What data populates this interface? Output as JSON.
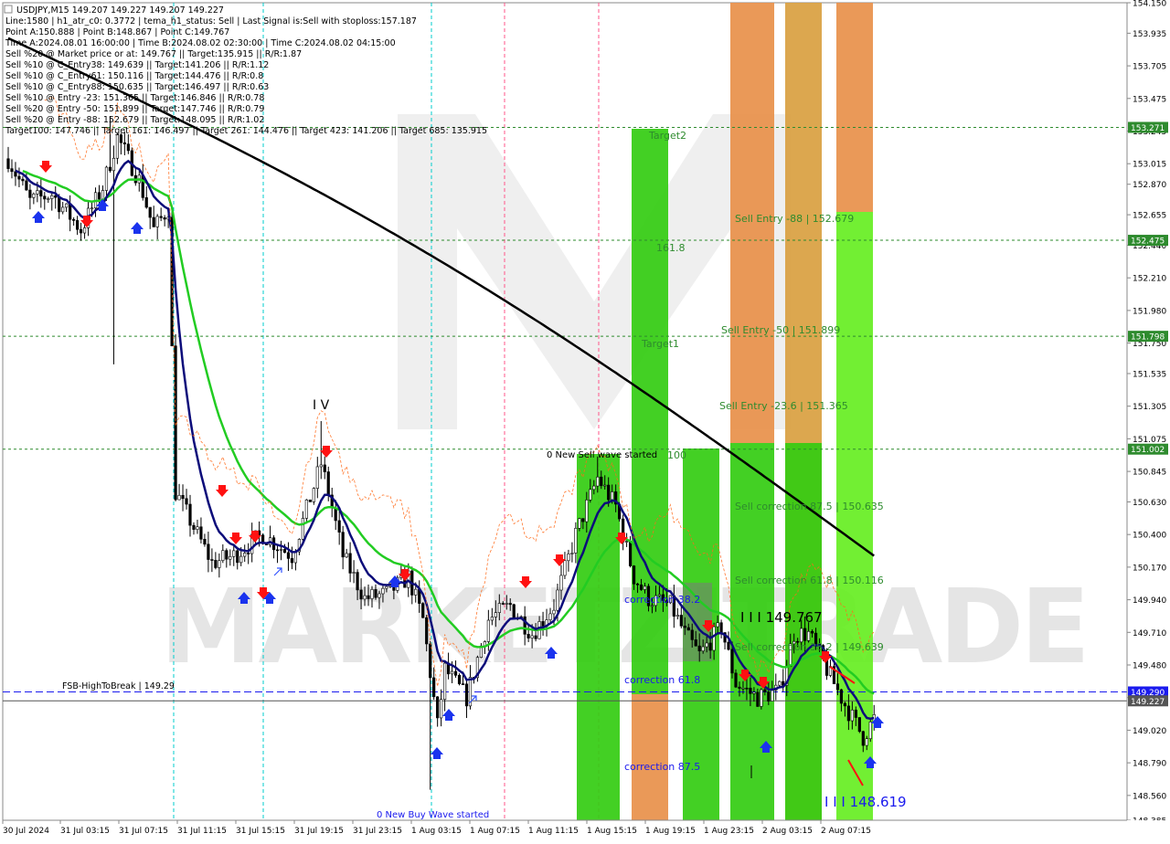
{
  "header": {
    "symbol_line": "USDJPY,M15  149.207 149.227 149.207 149.227",
    "info_lines": [
      "Line:1580 | h1_atr_c0: 0.3772 | tema_h1_status: Sell | Last Signal is:Sell with stoploss:157.187",
      "Point A:150.888 | Point B:148.867 | Point C:149.767",
      "Time A:2024.08.01 16:00:00 | Time B:2024.08.02 02:30:00 | Time C:2024.08.02 04:15:00",
      "Sell %20 @ Market price or at: 149.767 || Target:135.915 || R/R:1.87",
      "Sell %10 @ C_Entry38: 149.639 || Target:141.206 || R/R:1.12",
      "Sell %10 @ C_Entry61: 150.116 || Target:144.476 || R/R:0.8",
      "Sell %10 @ C_Entry88: 150.635 || Target:146.497 || R/R:0.63",
      "Sell %10 @ Entry -23: 151.365 || Target:146.846 || R/R:0.78",
      "Sell %20 @ Entry -50: 151.899 || Target:147.746 || R/R:0.79",
      "Sell %20 @ Entry -88: 152.679 || Target:148.095 || R/R:1.02",
      "Target100: 147.746 || Target 161: 146.497 || Target 261: 144.476 || Target 423: 141.206 || Target 685: 135.915"
    ]
  },
  "chart_data": {
    "type": "candlestick",
    "symbol": "USDJPY",
    "timeframe": "M15",
    "ylim": [
      148.385,
      154.15
    ],
    "y_ticks": [
      "154.150",
      "153.935",
      "153.705",
      "153.475",
      "153.245",
      "153.015",
      "152.870",
      "152.655",
      "152.440",
      "152.210",
      "151.980",
      "151.750",
      "151.535",
      "151.305",
      "151.075",
      "150.845",
      "150.630",
      "150.400",
      "150.170",
      "149.940",
      "149.710",
      "149.480",
      "149.250",
      "149.020",
      "148.790",
      "148.560",
      "148.385"
    ],
    "x_labels": [
      "30 Jul 2024",
      "31 Jul 03:15",
      "31 Jul 07:15",
      "31 Jul 11:15",
      "31 Jul 15:15",
      "31 Jul 19:15",
      "31 Jul 23:15",
      "1 Aug 03:15",
      "1 Aug 07:15",
      "1 Aug 11:15",
      "1 Aug 15:15",
      "1 Aug 19:15",
      "1 Aug 23:15",
      "2 Aug 03:15",
      "2 Aug 07:15"
    ],
    "price_levels": [
      {
        "value": 153.271,
        "label": "153.271",
        "color": "#2e8b2e",
        "style": "dotted"
      },
      {
        "value": 152.475,
        "label": "152.475",
        "color": "#2e8b2e",
        "style": "dotted"
      },
      {
        "value": 151.798,
        "label": "151.798",
        "color": "#2e8b2e",
        "style": "dotted"
      },
      {
        "value": 151.002,
        "label": "151.002",
        "color": "#2e8b2e",
        "style": "dotted"
      },
      {
        "value": 149.29,
        "label": "149.290",
        "color": "#1a1aee",
        "style": "dashed"
      },
      {
        "value": 149.227,
        "label": "149.227",
        "color": "#555555",
        "style": "solid"
      }
    ],
    "annotations": {
      "fsb": "FSB-HighToBreak | 149.29",
      "new_sell": "0 New Sell wave started",
      "new_buy": "0 New Buy Wave started",
      "iv": "I V",
      "point_c": "I I I 149.767",
      "point_b": "I I I 148.619",
      "target2": "Target2",
      "target1": "Target1",
      "fib_161": "161.8",
      "fib_100": "100",
      "sell_entry_88": "Sell Entry -88 | 152.679",
      "sell_entry_50": "Sell Entry -50 | 151.899",
      "sell_entry_23": "Sell Entry -23.6 | 151.365",
      "sell_corr_875": "Sell correction 87.5 | 150.635",
      "sell_corr_618": "Sell correction 61.8 | 150.116",
      "sell_corr_382": "Sell correction 38.2 | 149.639",
      "corr_382": "correction 38.2",
      "corr_618": "correction 61.8",
      "corr_875": "correction 87.5"
    },
    "watermark": "MARKETZITRADE",
    "colors": {
      "bright_green": "#33cc11",
      "lime_green": "#66ee22",
      "orange": "#f4a460",
      "dark_orange": "#e8904a",
      "tan": "#d9a040",
      "ma_black": "#000000",
      "ma_navy": "#0c0c7a",
      "ma_green": "#22cc22",
      "label_green": "#2e8b2e",
      "label_blue": "#1a1aee"
    }
  }
}
